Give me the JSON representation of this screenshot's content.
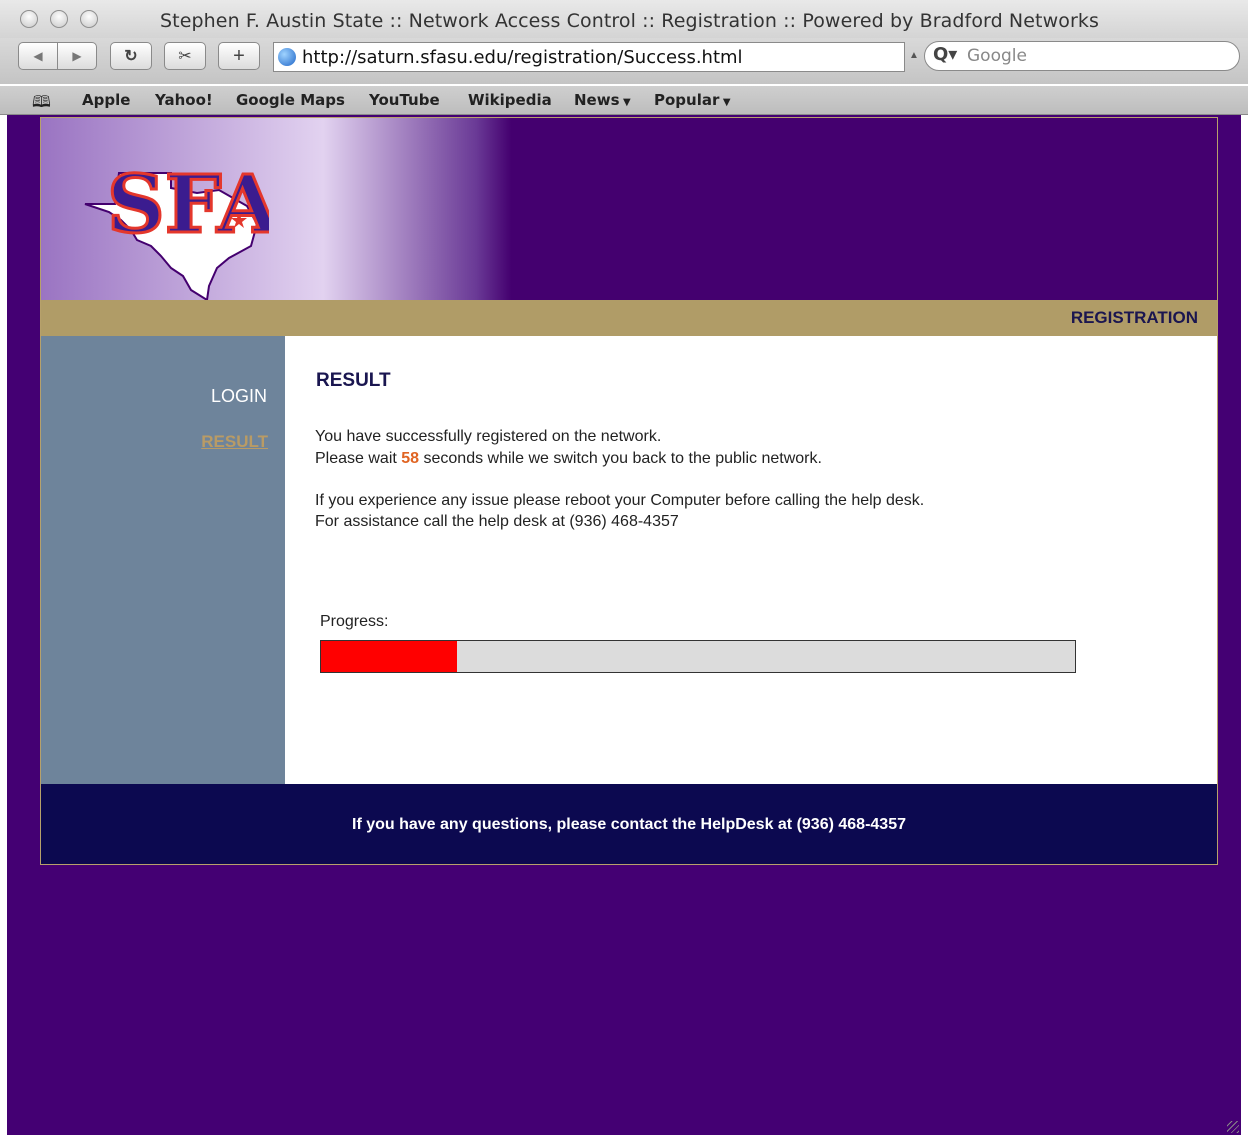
{
  "window": {
    "title": "Stephen F. Austin State :: Network Access Control :: Registration :: Powered by Bradford Networks"
  },
  "toolbar": {
    "url": "http://saturn.sfasu.edu/registration/Success.html",
    "search_placeholder": "Google"
  },
  "bookmarks": [
    "Apple",
    "Yahoo!",
    "Google Maps",
    "YouTube",
    "Wikipedia",
    "News",
    "Popular"
  ],
  "page": {
    "logo_text": "SFA",
    "section_title": "REGISTRATION",
    "nav": {
      "login": "LOGIN",
      "result": "RESULT"
    },
    "content": {
      "heading": "RESULT",
      "line1": "You have successfully registered on the network.",
      "line2_prefix": "Please wait ",
      "countdown": "58",
      "line2_suffix": " seconds while we switch you back to the public network.",
      "line3": "If you experience any issue please reboot your Computer before calling the help desk.",
      "line4": "For assistance call the help desk at (936) 468-4357",
      "progress_label": "Progress:",
      "progress_fraction": 0.18
    },
    "footer": "If you have any questions, please contact the HelpDesk at (936) 468-4357"
  },
  "colors": {
    "page_background": "#440073",
    "nav_sidebar": "#6e849b",
    "gold_bar": "#b09c67",
    "footer": "#0c0950",
    "countdown": "#e06422",
    "progress_fill": "#ff0000"
  }
}
